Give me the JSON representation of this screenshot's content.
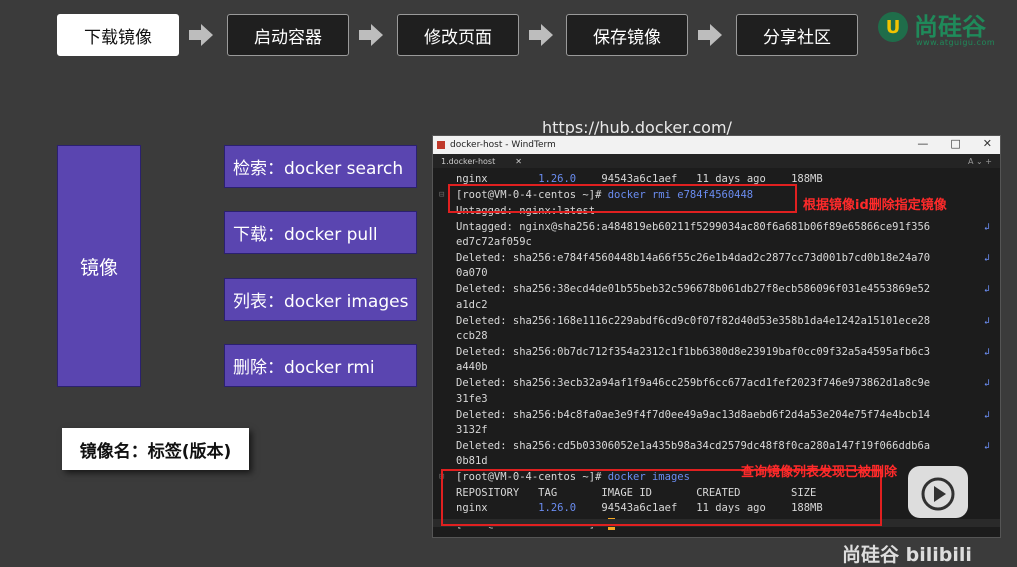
{
  "flow": {
    "steps": [
      "下载镜像",
      "启动容器",
      "修改页面",
      "保存镜像",
      "分享社区"
    ]
  },
  "logo": {
    "badge": "U",
    "name": "尚硅谷",
    "url": "www.atguigu.com"
  },
  "url_text": "https://hub.docker.com/",
  "image_box": "镜像",
  "commands": [
    "检索：docker search",
    "下载：docker pull",
    "列表：docker images",
    "删除：docker rmi"
  ],
  "tag_label": "镜像名：标签(版本)",
  "window": {
    "title": "docker-host - WindTerm",
    "tab": "1.docker-host",
    "controls": [
      "—",
      "□",
      "✕"
    ]
  },
  "terminal": {
    "row0": {
      "a": "nginx",
      "b": "1.26.0",
      "c": "94543a6c1aef   11 days ago    188MB"
    },
    "prompt1": "[root@VM-0-4-centos ~]#",
    "cmd1": " docker rmi e784f4560448",
    "untagged1": "Untagged: nginx:latest",
    "untagged2a": "Untagged: nginx@sha256:a484819eb60211f5299034ac80f6a681b06f89e65866ce91f356",
    "untagged2b": "ed7c72af059c",
    "deleted": [
      [
        "Deleted: sha256:e784f4560448b14a66f55c26e1b4dad2c2877cc73d001b7cd0b18e24a70",
        "0a070"
      ],
      [
        "Deleted: sha256:38ecd4de01b55beb32c596678b061db27f8ecb586096f031e4553869e52",
        "a1dc2"
      ],
      [
        "Deleted: sha256:168e1116c229abdf6cd9c0f07f82d40d53e358b1da4e1242a15101ece28",
        "ccb28"
      ],
      [
        "Deleted: sha256:0b7dc712f354a2312c1f1bb6380d8e23919baf0cc09f32a5a4595afb6c3",
        "a440b"
      ],
      [
        "Deleted: sha256:3ecb32a94af1f9a46cc259bf6cc677acd1fef2023f746e973862d1a8c9e",
        "31fe3"
      ],
      [
        "Deleted: sha256:b4c8fa0ae3e9f4f7d0ee49a9ac13d8aebd6f2d4a53e204e75f74e4bcb14",
        "3132f"
      ],
      [
        "Deleted: sha256:cd5b03306052e1a435b98a34cd2579dc48f8f0ca280a147f19f066ddb6a",
        "0b81d"
      ]
    ],
    "prompt2": "[root@VM-0-4-centos ~]#",
    "cmd2": " docker images",
    "header": "REPOSITORY   TAG       IMAGE ID       CREATED        SIZE",
    "row_name": "nginx",
    "row_tag": "1.26.0",
    "row_rest": "94543a6c1aef   11 days ago    188MB",
    "prompt3": "[root@VM-0-4-centos ~]#"
  },
  "annotations": {
    "delete_note": "根据镜像id删除指定镜像",
    "query_note": "查询镜像列表发现已被删除"
  },
  "watermark": "尚硅谷 bilibili"
}
